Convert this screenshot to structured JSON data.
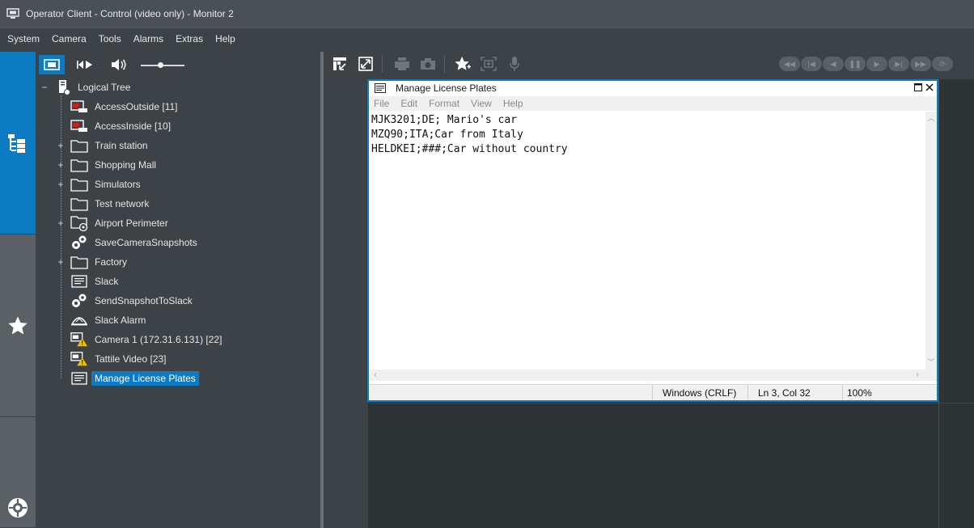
{
  "window": {
    "title": "Operator Client - Control (video only) - Monitor 2"
  },
  "menubar": {
    "items": [
      "System",
      "Camera",
      "Tools",
      "Alarms",
      "Extras",
      "Help"
    ]
  },
  "rail": {
    "items": [
      {
        "name": "logical-tree",
        "icon": "tree-icon",
        "active": true
      },
      {
        "name": "favorites",
        "icon": "star-icon",
        "active": false
      },
      {
        "name": "settings",
        "icon": "gear-wheel-icon",
        "active": false
      }
    ]
  },
  "tree_toolbar": {
    "buttons": [
      "live-mode-icon",
      "playback-mode-icon",
      "speaker-icon"
    ],
    "volume_level": 0.45
  },
  "tree": {
    "root": {
      "label": "Logical Tree",
      "icon": "server-icon",
      "expanded": true
    },
    "items": [
      {
        "label": "AccessOutside [11]",
        "icon": "access-camera-icon",
        "expandable": false
      },
      {
        "label": "AccessInside [10]",
        "icon": "access-camera-icon",
        "expandable": false
      },
      {
        "label": "Train station",
        "icon": "folder-icon",
        "expandable": true
      },
      {
        "label": "Shopping Mall",
        "icon": "folder-icon",
        "expandable": true
      },
      {
        "label": "Simulators",
        "icon": "folder-icon",
        "expandable": true
      },
      {
        "label": "Test network",
        "icon": "folder-icon",
        "expandable": false
      },
      {
        "label": "Airport Perimeter",
        "icon": "folder-gear-icon",
        "expandable": true
      },
      {
        "label": "SaveCameraSnapshots",
        "icon": "script-gears-icon",
        "expandable": false
      },
      {
        "label": "Factory",
        "icon": "folder-icon",
        "expandable": true
      },
      {
        "label": "Slack",
        "icon": "document-icon",
        "expandable": false
      },
      {
        "label": "SendSnapshotToSlack",
        "icon": "script-gears-icon",
        "expandable": false
      },
      {
        "label": "Slack Alarm",
        "icon": "alarm-icon",
        "expandable": false
      },
      {
        "label": "Camera 1 (172.31.6.131) [22]",
        "icon": "camera-warning-icon",
        "expandable": false
      },
      {
        "label": "Tattile Video [23]",
        "icon": "camera-warning-icon",
        "expandable": false
      },
      {
        "label": "Manage License Plates",
        "icon": "document-icon",
        "expandable": false,
        "selected": true
      }
    ]
  },
  "image_toolbar": {
    "buttons": [
      "tree-pane-icon",
      "fullscreen-icon",
      "print-icon",
      "snapshot-icon",
      "favorite-icon",
      "zoom-icon",
      "microphone-icon"
    ],
    "playback": [
      "fast-rewind-icon",
      "skip-back-icon",
      "step-back-icon",
      "pause-icon",
      "step-forward-icon",
      "skip-forward-icon",
      "fast-forward-icon",
      "loop-icon"
    ]
  },
  "notepad": {
    "title": "Manage License Plates",
    "menu": [
      "File",
      "Edit",
      "Format",
      "View",
      "Help"
    ],
    "lines": [
      "MJK3201;DE; Mario's car",
      "MZQ90;ITA;Car from Italy",
      "HELDKEI;###;Car without country"
    ],
    "status": {
      "line_ending": "Windows (CRLF)",
      "position": "Ln 3, Col 32",
      "zoom": "100%"
    }
  },
  "colors": {
    "accent": "#0c7bc4",
    "background": "#3c4246",
    "titlebar": "#4a5056",
    "rail": "#5a6064",
    "image_area": "#2d3235"
  }
}
